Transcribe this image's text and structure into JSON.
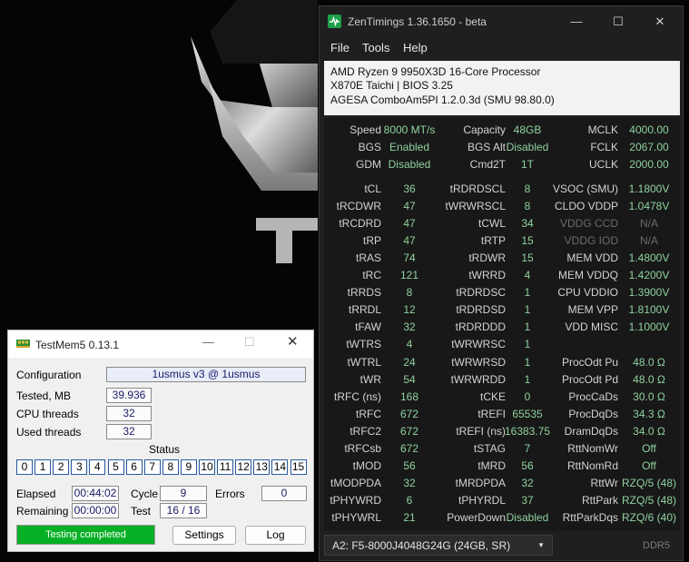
{
  "zentimings": {
    "title": "ZenTimings 1.36.1650 - beta",
    "menu": {
      "file": "File",
      "tools": "Tools",
      "help": "Help"
    },
    "window_buttons": {
      "minimize": "—",
      "maximize": "☐",
      "close": "✕"
    },
    "system": {
      "cpu": "AMD Ryzen 9 9950X3D 16-Core Processor",
      "board": "X870E Taichi | BIOS 3.25",
      "agesa": "AGESA ComboAm5PI 1.2.0.3d (SMU 98.80.0)"
    },
    "summary": [
      [
        "Speed",
        "8000 MT/s",
        "Capacity",
        "48GB",
        "MCLK",
        "4000.00"
      ],
      [
        "BGS",
        "Enabled",
        "BGS Alt",
        "Disabled",
        "FCLK",
        "2067.00"
      ],
      [
        "GDM",
        "Disabled",
        "Cmd2T",
        "1T",
        "UCLK",
        "2000.00"
      ]
    ],
    "timings": [
      [
        "tCL",
        "36",
        "tRDRDSCL",
        "8",
        "VSOC (SMU)",
        "1.1800V"
      ],
      [
        "tRCDWR",
        "47",
        "tWRWRSCL",
        "8",
        "CLDO VDDP",
        "1.0478V"
      ],
      [
        "tRCDRD",
        "47",
        "tCWL",
        "34",
        "VDDG CCD",
        "N/A"
      ],
      [
        "tRP",
        "47",
        "tRTP",
        "15",
        "VDDG IOD",
        "N/A"
      ],
      [
        "tRAS",
        "74",
        "tRDWR",
        "15",
        "MEM VDD",
        "1.4800V"
      ],
      [
        "tRC",
        "121",
        "tWRRD",
        "4",
        "MEM VDDQ",
        "1.4200V"
      ],
      [
        "tRRDS",
        "8",
        "tRDRDSC",
        "1",
        "CPU VDDIO",
        "1.3900V"
      ],
      [
        "tRRDL",
        "12",
        "tRDRDSD",
        "1",
        "MEM VPP",
        "1.8100V"
      ],
      [
        "tFAW",
        "32",
        "tRDRDDD",
        "1",
        "VDD MISC",
        "1.1000V"
      ],
      [
        "tWTRS",
        "4",
        "tWRWRSC",
        "1",
        "",
        ""
      ],
      [
        "tWTRL",
        "24",
        "tWRWRSD",
        "1",
        "ProcOdt Pu",
        "48.0 Ω"
      ],
      [
        "tWR",
        "54",
        "tWRWRDD",
        "1",
        "ProcOdt Pd",
        "48.0 Ω"
      ],
      [
        "tRFC (ns)",
        "168",
        "tCKE",
        "0",
        "ProcCaDs",
        "30.0 Ω"
      ],
      [
        "tRFC",
        "672",
        "tREFI",
        "65535",
        "ProcDqDs",
        "34.3 Ω"
      ],
      [
        "tRFC2",
        "672",
        "tREFI (ns)",
        "16383.75",
        "DramDqDs",
        "34.0 Ω"
      ],
      [
        "tRFCsb",
        "672",
        "tSTAG",
        "7",
        "RttNomWr",
        "Off"
      ],
      [
        "tMOD",
        "56",
        "tMRD",
        "56",
        "RttNomRd",
        "Off"
      ],
      [
        "tMODPDA",
        "32",
        "tMRDPDA",
        "32",
        "RttWr",
        "RZQ/5 (48)"
      ],
      [
        "tPHYWRD",
        "6",
        "tPHYRDL",
        "37",
        "RttPark",
        "RZQ/5 (48)"
      ],
      [
        "tPHYWRL",
        "21",
        "PowerDown",
        "Disabled",
        "RttParkDqs",
        "RZQ/6 (40)"
      ]
    ],
    "dimmed_rows": [
      2,
      3
    ],
    "dimm_selected": "A2: F5-8000J4048G24G (24GB, SR)",
    "memory_type": "DDR5",
    "colors": {
      "value": "#8fd19e",
      "label": "#d2d2d2",
      "dim": "#6b6b6b",
      "background": "#1f1f1f"
    }
  },
  "testmem5": {
    "title": "TestMem5  0.13.1",
    "window_buttons": {
      "minimize": "—",
      "maximize": "☐",
      "close": "✕"
    },
    "configuration_label": "Configuration",
    "configuration_value": "1usmus v3 @ 1usmus",
    "tested_label": "Tested, MB",
    "tested_value": "39.936",
    "cpu_threads_label": "CPU threads",
    "cpu_threads_value": "32",
    "used_threads_label": "Used threads",
    "used_threads_value": "32",
    "status_label": "Status",
    "status_cells": [
      "0",
      "1",
      "2",
      "3",
      "4",
      "5",
      "6",
      "7",
      "8",
      "9",
      "10",
      "11",
      "12",
      "13",
      "14",
      "15"
    ],
    "elapsed_label": "Elapsed",
    "elapsed_value": "00:44:02",
    "cycle_label": "Cycle",
    "cycle_value": "9",
    "errors_label": "Errors",
    "errors_value": "0",
    "remaining_label": "Remaining",
    "remaining_value": "00:00:00",
    "test_label": "Test",
    "test_value": "16 / 16",
    "progress_text": "Testing completed",
    "progress_fraction": 1.0,
    "settings_button": "Settings",
    "log_button": "Log",
    "colors": {
      "progress": "#06b025"
    }
  }
}
